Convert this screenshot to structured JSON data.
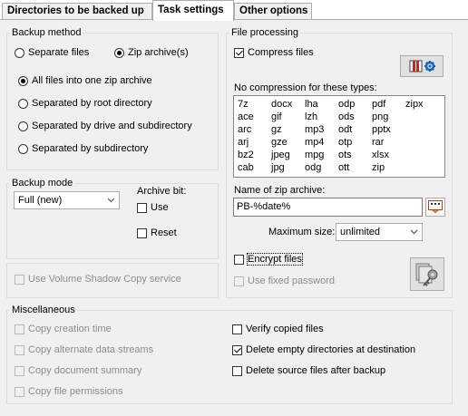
{
  "tabs": [
    "Directories to be backed up",
    "Task settings",
    "Other options"
  ],
  "backup_method": {
    "title": "Backup method",
    "separate_files": "Separate files",
    "zip_archives": "Zip archive(s)",
    "all_files_one_zip": "All files into one zip archive",
    "by_root": "Separated by root directory",
    "by_drive_subdir": "Separated by drive and subdirectory",
    "by_subdir": "Separated by subdirectory"
  },
  "backup_mode": {
    "title": "Backup mode",
    "mode_value": "Full (new)",
    "archive_bit_label": "Archive bit:",
    "use_label": "Use",
    "reset_label": "Reset"
  },
  "vss": {
    "label": "Use Volume Shadow Copy service"
  },
  "file_processing": {
    "title": "File processing",
    "compress_label": "Compress files",
    "no_compression_label": "No compression for these types:",
    "extensions": [
      [
        "7z",
        "docx",
        "lha",
        "odp",
        "pdf",
        "zipx"
      ],
      [
        "ace",
        "gif",
        "lzh",
        "ods",
        "png"
      ],
      [
        "arc",
        "gz",
        "mp3",
        "odt",
        "pptx"
      ],
      [
        "arj",
        "gze",
        "mp4",
        "otp",
        "rar"
      ],
      [
        "bz2",
        "jpeg",
        "mpg",
        "ots",
        "xlsx"
      ],
      [
        "cab",
        "jpg",
        "odg",
        "ott",
        "zip"
      ]
    ],
    "zip_name_label": "Name of zip archive:",
    "zip_name_value": "PB-%date%",
    "max_size_label": "Maximum size:",
    "max_size_value": "unlimited",
    "encrypt_label": "Encrypt files",
    "fixed_password_label": "Use fixed password"
  },
  "misc": {
    "title": "Miscellaneous",
    "copy_creation_time": "Copy creation time",
    "copy_ads": "Copy alternate data streams",
    "copy_doc_summary": "Copy document summary",
    "copy_permissions": "Copy file permissions",
    "verify": "Verify copied files",
    "delete_empty": "Delete empty directories at destination",
    "delete_source": "Delete source files after backup"
  },
  "icons": {
    "settings": "compress-settings-icon",
    "placeholder": "placeholder-menu-icon",
    "keys": "password-keys-icon"
  },
  "colors": {
    "panel_bg": "#f0f0f0",
    "group_border": "#dcdcdc",
    "disabled_text": "#8c8c8c"
  }
}
